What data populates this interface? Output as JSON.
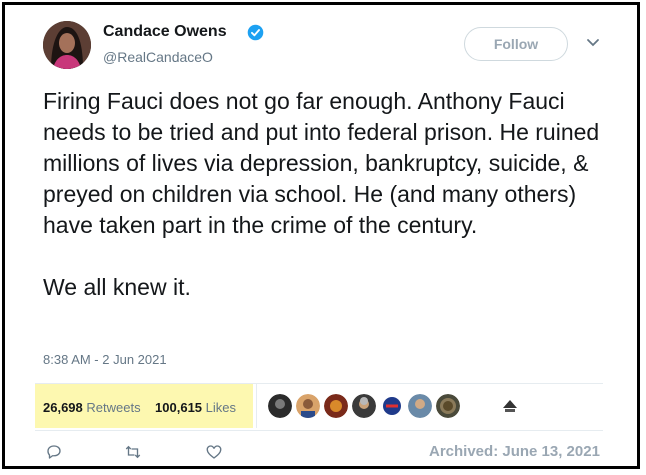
{
  "author": {
    "name": "Candace Owens",
    "handle": "@RealCandaceO",
    "verified": true
  },
  "follow_button": {
    "label": "Follow"
  },
  "tweet": {
    "paragraphs": [
      "Firing Fauci does not go far enough. Anthony Fauci needs to be tried and put into federal prison. He ruined millions of lives via depression, bankruptcy, suicide, & preyed on children via school. He (and many others) have taken part in the crime of the century.",
      "We all knew it."
    ],
    "timestamp": "8:38 AM - 2 Jun 2021"
  },
  "stats": {
    "retweets_count": "26,698",
    "retweets_label": "Retweets",
    "likes_count": "100,615",
    "likes_label": "Likes"
  },
  "liker_avatars": [
    "avatar-1",
    "avatar-2",
    "avatar-3",
    "avatar-4",
    "avatar-5",
    "avatar-6",
    "avatar-7",
    "avatar-8"
  ],
  "actions": [
    "reply-icon",
    "retweet-icon",
    "like-icon"
  ],
  "archived": "Archived: June 13, 2021",
  "colors": {
    "verified": "#1da1f2",
    "highlight": "#fdf8b0",
    "muted": "#657786"
  }
}
